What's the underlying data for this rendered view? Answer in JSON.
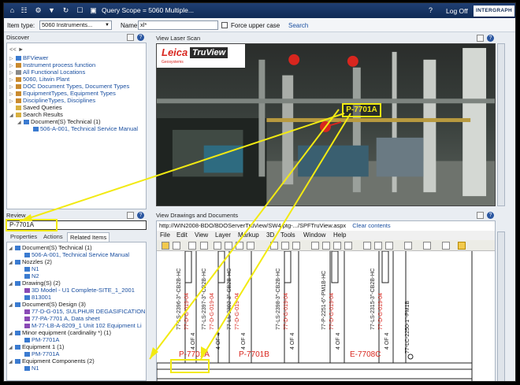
{
  "topbar": {
    "scope": "Query Scope = 5060  Multiple...",
    "logoff": "Log Off",
    "brand": "INTERGRAPH"
  },
  "search": {
    "item_type_label": "Item type:",
    "item_type_value": "5060 Instruments...",
    "name_label": "Name:",
    "name_value": "xl*",
    "force_upper": "Force upper case",
    "search_link": "Search"
  },
  "discover": {
    "title": "Discover",
    "collapse": "<< ►",
    "items": [
      {
        "label": "BFViewer"
      },
      {
        "label": "Instrument process function"
      },
      {
        "label": "All Functional Locations"
      },
      {
        "label": "5060, Litwin Plant"
      },
      {
        "label": "DOC Document Types, Document Types"
      },
      {
        "label": "EquipmentTypes, Equipment Types"
      },
      {
        "label": "DisciplineTypes, Disciplines"
      },
      {
        "label": "Saved Queries"
      },
      {
        "label": "Search Results"
      },
      {
        "label": "Document(S) Technical (1)"
      },
      {
        "label": "506-A-001, Technical Service Manual"
      }
    ]
  },
  "review": {
    "title": "Review",
    "input_value": "P-7701A",
    "tabs": [
      "Properties",
      "Actions",
      "Related Items"
    ],
    "items": [
      {
        "label": "Document(S) Technical (1)"
      },
      {
        "label": "506-A-001, Technical Service Manual"
      },
      {
        "label": "Nozzles (2)"
      },
      {
        "label": "N1"
      },
      {
        "label": "N2"
      },
      {
        "label": "Drawing(S) (2)"
      },
      {
        "label": "3D Model - U1 Complete-SITE_1_2001"
      },
      {
        "label": "813001"
      },
      {
        "label": "Document(S) Design (3)"
      },
      {
        "label": "77-D-G-015, SULPHUR DEGASIFICATION"
      },
      {
        "label": "77-PA-7701 A, Data sheet"
      },
      {
        "label": "M-77-LB-A-8209_1 Unit 102 Equipment Li"
      },
      {
        "label": "Minor equipment (cardinality *) (1)"
      },
      {
        "label": "PM-7701A"
      },
      {
        "label": "Equipment 1 (1)"
      },
      {
        "label": "PM-7701A"
      },
      {
        "label": "Equipment Components (2)"
      },
      {
        "label": "N1"
      }
    ]
  },
  "scan": {
    "title": "View Laser Scan",
    "logo_left": "Leica",
    "logo_right": "TruView",
    "logo_sub": "Geosystems",
    "callout": "P-7701A"
  },
  "drawings": {
    "title": "View Drawings and Documents",
    "url": "http://WIN2008-BDO/BDOServerTruView/SW4.ptg-.../SPFTruView.aspx",
    "clear_contents": "Clear contents",
    "menu": [
      "File",
      "Edit",
      "View",
      "Layer",
      "Markup",
      "3D",
      "Tools",
      "Window",
      "Help"
    ],
    "vertical_texts": [
      {
        "text": "77-LS-2396-3\"-CB2B-HC"
      },
      {
        "text": "77-D-G-019-04"
      },
      {
        "text": "4 OF 4"
      },
      {
        "text": "77-LS-2397-3\"-CB2B-HC"
      },
      {
        "text": "77-D-G-019-04"
      },
      {
        "text": "4 OF 4"
      },
      {
        "text": "77-LS-2302-3\"-CB2B-HC"
      },
      {
        "text": "77-D-G-019-04"
      },
      {
        "text": "4 OF 4"
      },
      {
        "text": "77-LS-2398-3\"-CB2B-HC"
      },
      {
        "text": "77-D-G-019-04"
      },
      {
        "text": "4 OF 4"
      },
      {
        "text": "77-P-2251-6\"-PM1B-HC"
      },
      {
        "text": "77-D-G-019-04"
      },
      {
        "text": "4 OF 4"
      },
      {
        "text": "77-LS-2315-3\"-CB2B-HC"
      },
      {
        "text": "77-D-G-019-04"
      },
      {
        "text": "4 OF 4"
      },
      {
        "text": "77-LC-2250-1\"-PM1B"
      }
    ],
    "equipment_labels": [
      "P-7701A",
      "P-7701B",
      "E-7708C"
    ]
  },
  "colors": {
    "accent_yellow": "#f2ea12",
    "navy": "#0f2a55",
    "link_blue": "#1a4fa0",
    "drawing_red": "#d8261e"
  }
}
